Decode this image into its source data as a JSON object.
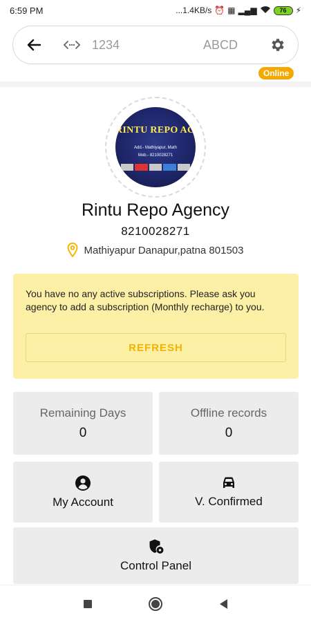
{
  "status_bar": {
    "time": "6:59 PM",
    "network_speed": "...1.4KB/s",
    "battery": "76"
  },
  "top_bar": {
    "code": "1234",
    "name": "ABCD",
    "icons": [
      "back-arrow-icon",
      "code-icon",
      "gear-icon"
    ]
  },
  "status_badge": "Online",
  "profile": {
    "avatar_title": "RINTU REPO AGENCY",
    "avatar_line1": "Add.- Mathiyapur, Math",
    "avatar_line2": "Mob.- 8210028271",
    "name": "Rintu Repo Agency",
    "phone": "8210028271",
    "address": "Mathiyapur Danapur,patna 801503"
  },
  "notice": {
    "message": "You have no any active subscriptions. Please ask you agency to add a subscription (Monthly recharge) to you.",
    "button_label": "REFRESH"
  },
  "stats": {
    "remaining_days_label": "Remaining Days",
    "remaining_days_value": "0",
    "offline_records_label": "Offline records",
    "offline_records_value": "0"
  },
  "actions": {
    "my_account_label": "My Account",
    "confirmed_label": "V. Confirmed",
    "control_panel_label": "Control Panel"
  },
  "colors": {
    "accent": "#f5a800",
    "notice_bg": "#fcefa6",
    "tile_bg": "#ececec"
  }
}
